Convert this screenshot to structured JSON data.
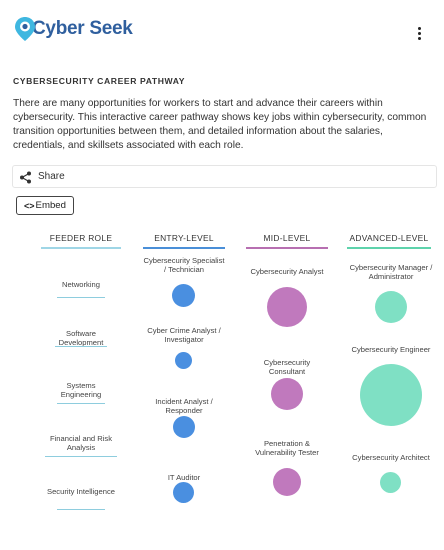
{
  "app": {
    "logo_text": "Cyber Seek",
    "menu_icon": "kebab-menu-icon"
  },
  "page": {
    "section_title": "CYBERSECURITY CAREER PATHWAY",
    "intro": "There are many opportunities for workers to start and advance their careers within cybersecurity. This interactive career pathway shows key jobs within cybersecurity, common transition opportunities between them, and detailed information about the salaries, credentials, and skillsets associated with each role."
  },
  "share": {
    "label": "Share",
    "icon": "share-icon"
  },
  "embed": {
    "code_glyph": "<>",
    "label": "Embed"
  },
  "columns": [
    {
      "label": "FEEDER ROLE",
      "color": "#9fd6e6"
    },
    {
      "label": "ENTRY-LEVEL",
      "color": "#4a8fd8"
    },
    {
      "label": "MID-LEVEL",
      "color": "#b76fb1"
    },
    {
      "label": "ADVANCED-LEVEL",
      "color": "#5ed3ac"
    }
  ],
  "feeder_roles": [
    "Networking",
    "Software Development",
    "Systems Engineering",
    "Financial and Risk Analysis",
    "Security Intelligence"
  ],
  "entry_level": [
    {
      "label": "Cybersecurity Specialist / Technician",
      "color": "#4a8fe0"
    },
    {
      "label": "Cyber Crime Analyst / Investigator",
      "color": "#4a8fe0"
    },
    {
      "label": "Incident Analyst / Responder",
      "color": "#4a8fe0"
    },
    {
      "label": "IT Auditor",
      "color": "#4a8fe0"
    }
  ],
  "mid_level": [
    {
      "label": "Cybersecurity Analyst",
      "color": "#c079bd"
    },
    {
      "label": "Cybersecurity Consultant",
      "color": "#c079bd"
    },
    {
      "label": "Penetration & Vulnerability Tester",
      "color": "#c079bd"
    }
  ],
  "advanced_level": [
    {
      "label": "Cybersecurity Manager / Administrator",
      "color": "#7fe0c4"
    },
    {
      "label": "Cybersecurity Engineer",
      "color": "#7fe0c4"
    },
    {
      "label": "Cybersecurity Architect",
      "color": "#7fe0c4"
    }
  ]
}
